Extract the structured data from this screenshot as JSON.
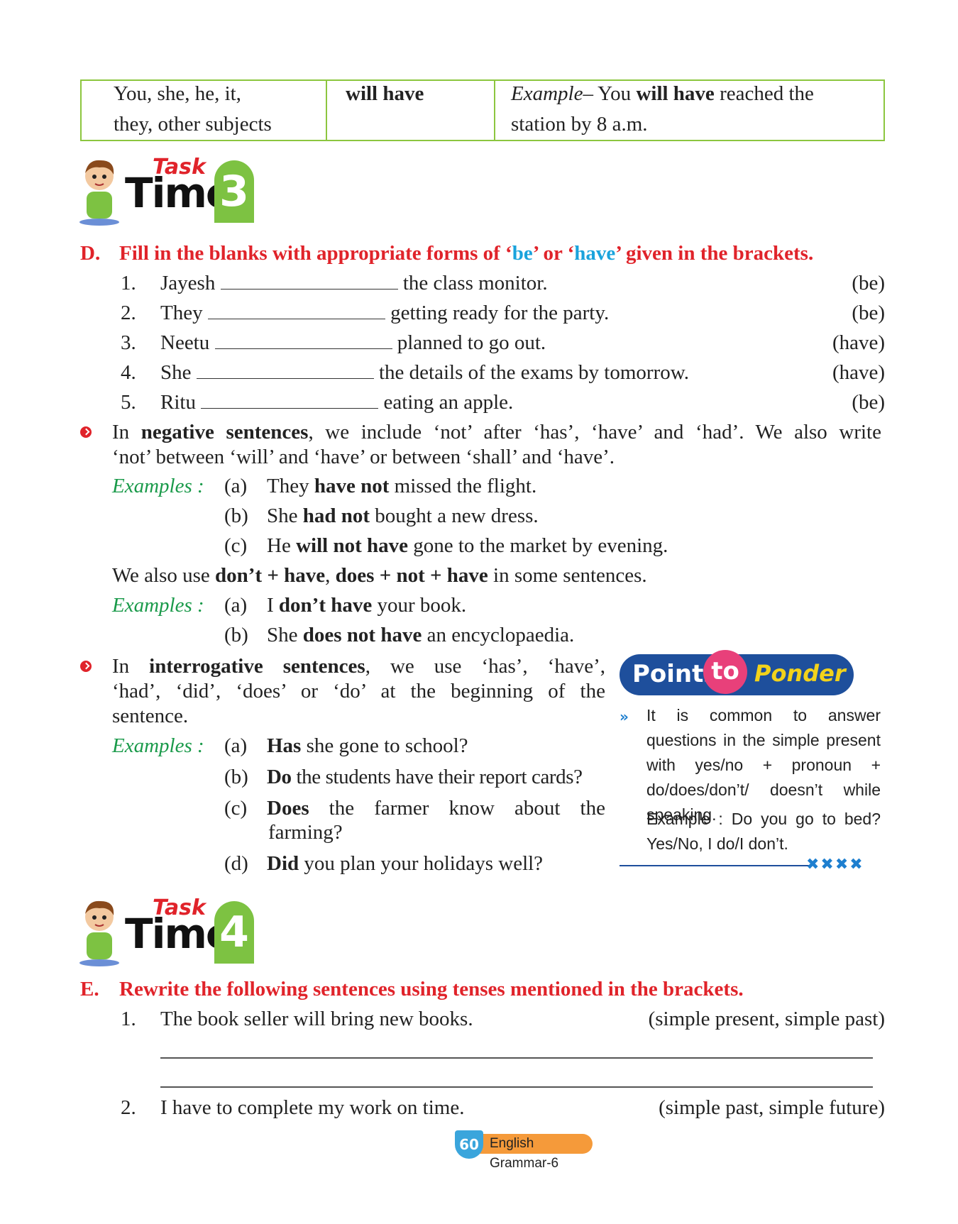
{
  "table": {
    "col1": [
      "You, she, he, it,",
      "they, other subjects"
    ],
    "col2": "will have",
    "col3_example_label": "Example",
    "col3_dash": "– You ",
    "col3_bold": "will have",
    "col3_rest": " reached the",
    "col3_line2": "station by 8 a.m."
  },
  "task3": {
    "task": "Task",
    "time": "Time",
    "num": "3"
  },
  "sectionD": {
    "letter": "D.",
    "title_a": "Fill in the blanks with appropriate forms of ‘",
    "be": "be",
    "title_b": "’ or ‘",
    "have": "have",
    "title_c": "’ given in the brackets.",
    "items": [
      {
        "n": "1.",
        "subject": "Jayesh",
        "rest": "the class monitor.",
        "hint": "(be)"
      },
      {
        "n": "2.",
        "subject": "They",
        "rest": "getting ready for the party.",
        "hint": "(be)"
      },
      {
        "n": "3.",
        "subject": "Neetu",
        "rest": "planned to go out.",
        "hint": "(have)"
      },
      {
        "n": "4.",
        "subject": "She",
        "rest": "the details of the exams by tomorrow.",
        "hint": "(have)"
      },
      {
        "n": "5.",
        "subject": "Ritu",
        "rest": "eating an apple.",
        "hint": "(be)"
      }
    ]
  },
  "negative": {
    "line1_a": "In ",
    "line1_b": "negative sentences",
    "line1_c": ", we include ‘not’ after ‘has’, ‘have’ and ‘had’. We also write",
    "line2": "‘not’ between ‘will’ and ‘have’ or between ‘shall’ and ‘have’.",
    "examples_label": "Examples :",
    "examples": [
      {
        "l": "(a)",
        "pre": "They ",
        "bold": "have not",
        "post": " missed the flight."
      },
      {
        "l": "(b)",
        "pre": "She ",
        "bold": "had not",
        "post": " bought a new dress."
      },
      {
        "l": "(c)",
        "pre": "He ",
        "bold": "will not have",
        "post": " gone to the market by evening."
      }
    ],
    "also_a": "We also use ",
    "also_b": "don’t + have",
    "also_c": ", ",
    "also_d": "does + not + have",
    "also_e": " in some sentences.",
    "examples2": [
      {
        "l": "(a)",
        "pre": "I ",
        "bold": "don’t have",
        "post": " your book."
      },
      {
        "l": "(b)",
        "pre": "She ",
        "bold": "does not have",
        "post": " an encyclopaedia."
      }
    ]
  },
  "interrogative": {
    "line1_a": "In ",
    "line1_b": "interrogative sentences",
    "line1_c": ", we use ‘has’, ‘have’,",
    "line2": "‘had’, ‘did’, ‘does’ or ‘do’ at the beginning of the",
    "line3": "sentence.",
    "examples_label": "Examples :",
    "examples": [
      {
        "l": "(a)",
        "bold": "Has",
        "post": " she gone to school?"
      },
      {
        "l": "(b)",
        "bold": "Do",
        "post": " the students have their report cards?"
      },
      {
        "l": "(c)",
        "bold": "Does",
        "post": " the farmer know about the",
        "post2": "farming?"
      },
      {
        "l": "(d)",
        "bold": "Did",
        "post": " you plan your holidays well?"
      }
    ]
  },
  "ponder": {
    "w1": "Points",
    "w2": "to",
    "w3": "Ponder",
    "text": "It is common to answer questions in the simple present with yes/no + pronoun + do/does/don’t/ doesn’t while speaking.",
    "example": "Example : Do you go to bed? Yes/No, I do/I don’t.",
    "marks": "✖✖✖✖"
  },
  "task4": {
    "task": "Task",
    "time": "Time",
    "num": "4"
  },
  "sectionE": {
    "letter": "E.",
    "title": "Rewrite the following sentences using tenses mentioned in the brackets.",
    "items": [
      {
        "n": "1.",
        "text": "The book seller will bring new books.",
        "hint": "(simple present, simple past)"
      },
      {
        "n": "2.",
        "text": "I have to complete my work on time.",
        "hint": "(simple past, simple future)"
      }
    ]
  },
  "footer": {
    "page": "60",
    "book": "English Grammar-6"
  },
  "colors": {
    "heading_red": "#e0232a",
    "accent_blue": "#1aa3dc",
    "example_green": "#1a9a4a",
    "table_border": "#8cc63f"
  }
}
